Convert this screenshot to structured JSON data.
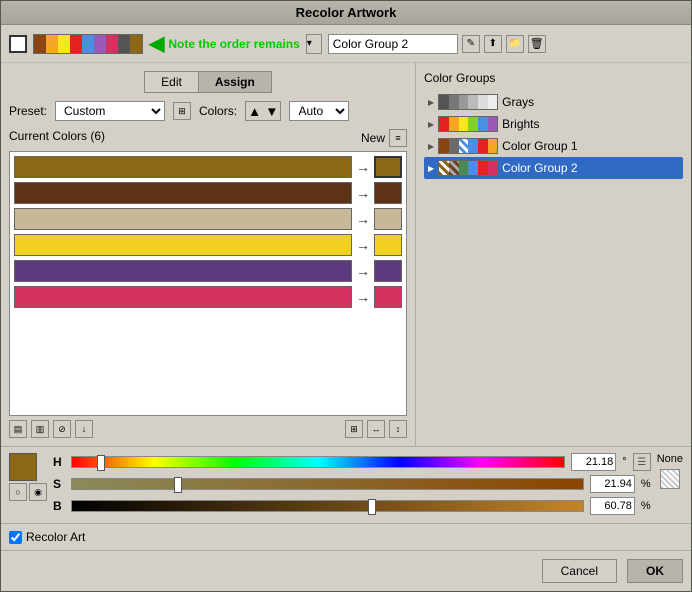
{
  "title": "Recolor Artwork",
  "toolbar": {
    "note_text": "Note the order remains",
    "color_group_value": "Color Group 2",
    "dropdown_arrow": "▾"
  },
  "tabs": {
    "edit_label": "Edit",
    "assign_label": "Assign"
  },
  "preset": {
    "label": "Preset:",
    "value": "Custom",
    "colors_label": "Colors:",
    "colors_value": "Auto"
  },
  "current_colors": {
    "header": "Current Colors (6)",
    "new_label": "New"
  },
  "hsb": {
    "h_label": "H",
    "s_label": "S",
    "b_label": "B",
    "h_value": "21.18",
    "s_value": "21.94",
    "b_value": "60.78",
    "h_unit": "°",
    "s_unit": "%",
    "b_unit": "%",
    "none_label": "None"
  },
  "recolor": {
    "checkbox_label": "Recolor Art"
  },
  "buttons": {
    "cancel": "Cancel",
    "ok": "OK"
  },
  "color_groups": {
    "title": "Color Groups",
    "items": [
      {
        "name": "Grays",
        "swatches": [
          "#555",
          "#777",
          "#999",
          "#bbb",
          "#ddd",
          "#eee"
        ]
      },
      {
        "name": "Brights",
        "swatches": [
          "#e52222",
          "#f5a623",
          "#f8e71c",
          "#7ed321",
          "#4a90e2",
          "#9b59b6"
        ]
      },
      {
        "name": "Color Group 1",
        "swatches": [
          "#8B4513",
          "#6B6B6B",
          "#556b2f",
          "#4a90e2",
          "#e52222",
          "#f5a623"
        ]
      },
      {
        "name": "Color Group 2",
        "swatches": [
          "#8B6914",
          "#6B4226",
          "#c8b89a",
          "#f0d060",
          "#5b3a7e",
          "#d43060"
        ],
        "selected": true
      }
    ]
  },
  "color_rows": [
    {
      "bar_color": "#8B6914",
      "new_color": "#8B6914"
    },
    {
      "bar_color": "#5C3317",
      "new_color": "#5C3317"
    },
    {
      "bar_color": "#C8B89A",
      "new_color": "#C8B89A"
    },
    {
      "bar_color": "#F0D060",
      "new_color": "#F0D060"
    },
    {
      "bar_color": "#5B3A7E",
      "new_color": "#5B3A7E"
    },
    {
      "bar_color": "#D43060",
      "new_color": "#D43060"
    }
  ]
}
